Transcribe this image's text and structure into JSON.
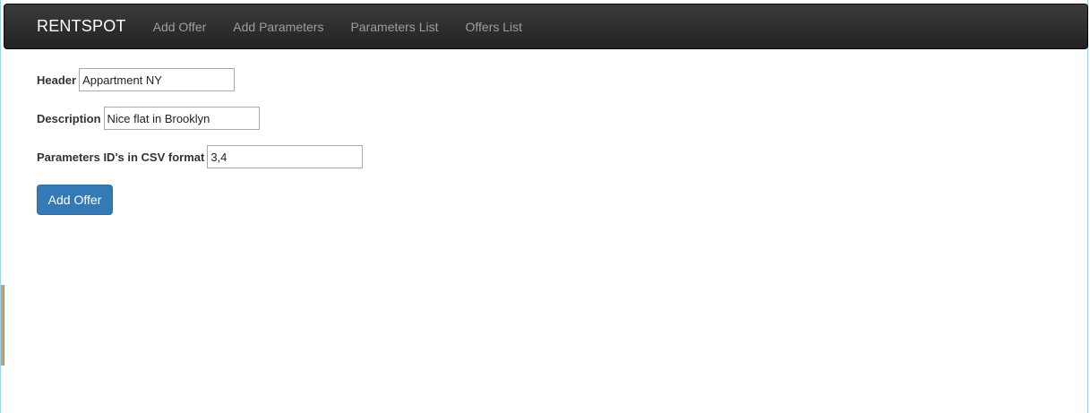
{
  "navbar": {
    "brand": "RENTSPOT",
    "links": [
      "Add Offer",
      "Add Parameters",
      "Parameters List",
      "Offers List"
    ]
  },
  "form": {
    "fields": [
      {
        "label": "Header",
        "value": "Appartment NY"
      },
      {
        "label": "Description",
        "value": "Nice flat in Brooklyn"
      },
      {
        "label": "Parameters ID's in CSV format",
        "value": "3,4"
      }
    ],
    "submit_label": "Add Offer"
  },
  "colors": {
    "navbar_bg": "#222222",
    "brand_text": "#ffffff",
    "nav_link_text": "#9d9d9d",
    "primary_button": "#337ab7"
  }
}
